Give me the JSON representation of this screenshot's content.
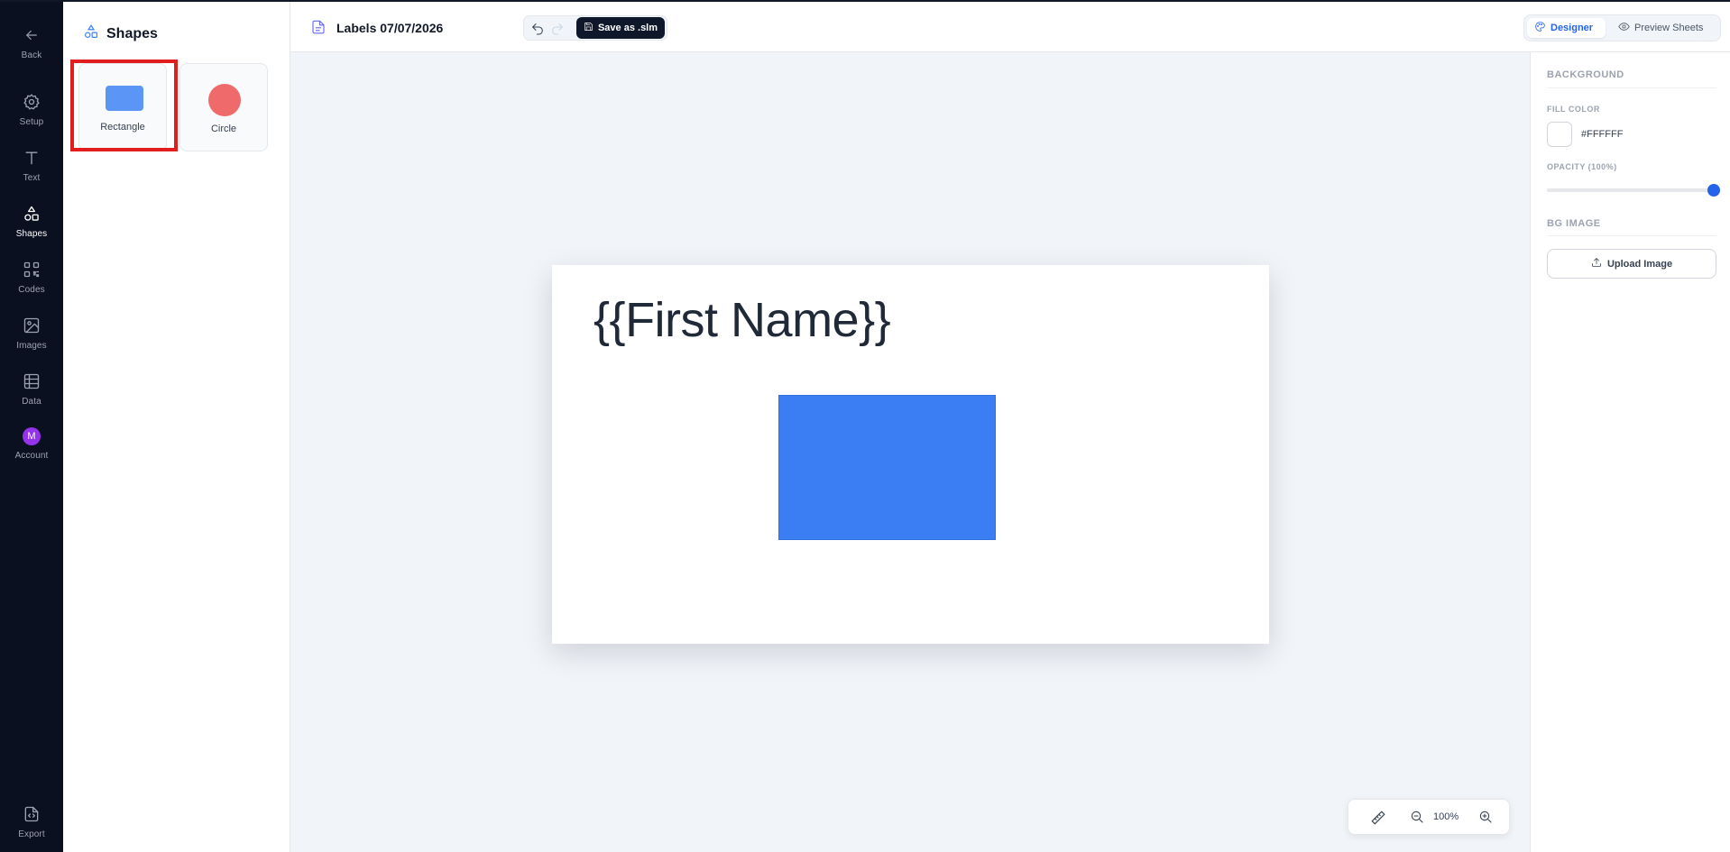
{
  "rail": {
    "back": "Back",
    "setup": "Setup",
    "text": "Text",
    "shapes": "Shapes",
    "codes": "Codes",
    "images": "Images",
    "data": "Data",
    "account": "Account",
    "account_initial": "M",
    "export": "Export"
  },
  "panel": {
    "title": "Shapes",
    "shapes": [
      {
        "label": "Rectangle",
        "color": "#5B95F5"
      },
      {
        "label": "Circle",
        "color": "#EF6B6B"
      }
    ]
  },
  "toolbar": {
    "doc_title": "Labels 07/07/2026",
    "save_label": "Save as .slm",
    "mode_designer": "Designer",
    "mode_preview": "Preview Sheets"
  },
  "canvas": {
    "text_field": "{{First Name}}",
    "rect_color": "#3B7EF3",
    "zoom": "100%"
  },
  "props": {
    "background_title": "BACKGROUND",
    "fill_color_label": "FILL COLOR",
    "fill_color_value": "#FFFFFF",
    "opacity_label": "OPACITY (100%)",
    "opacity_value": 1.0,
    "bg_image_title": "BG IMAGE",
    "upload_label": "Upload Image"
  },
  "colors": {
    "rail_bg": "#0B1020",
    "accent": "#2563EB",
    "canvas_bg": "#F1F4F8",
    "highlight": "#E11D1D"
  }
}
